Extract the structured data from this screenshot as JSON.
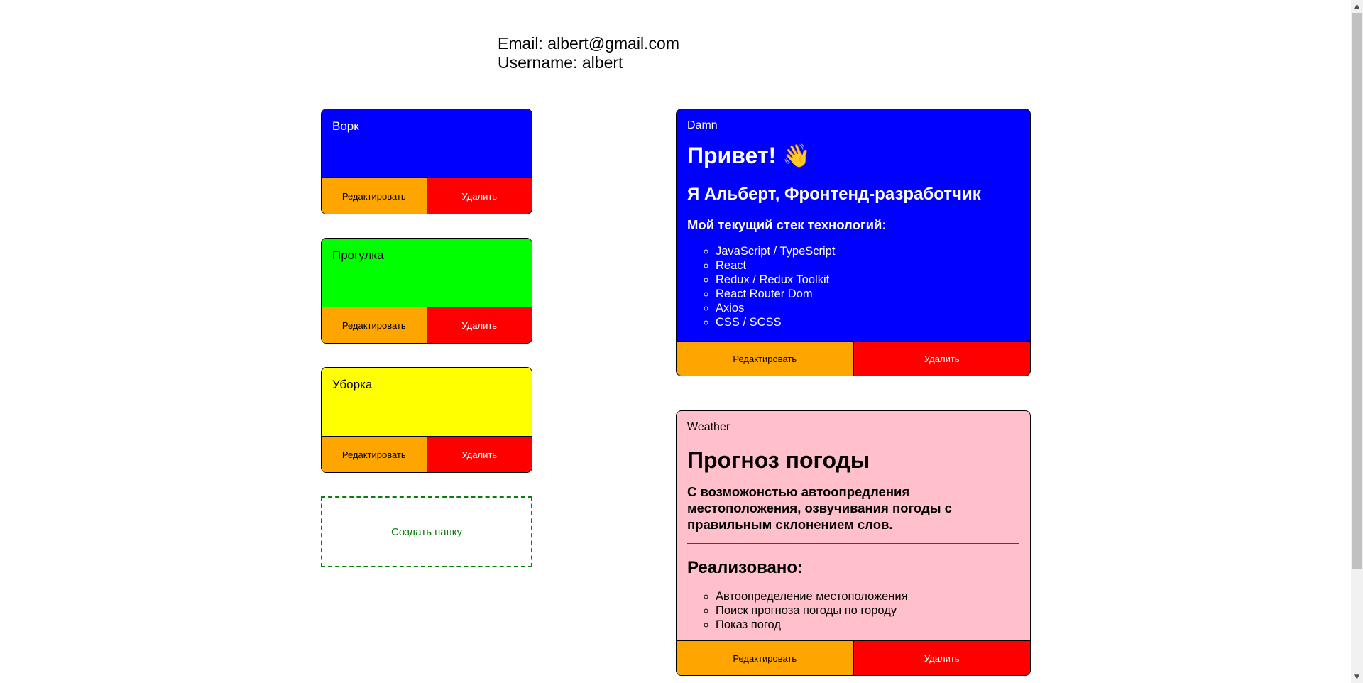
{
  "profile": {
    "email_line": "Email: albert@gmail.com",
    "username_line": "Username: albert"
  },
  "colors": {
    "edit_button": "#ffa500",
    "delete_button": "#ff0000",
    "create_folder_border": "#0a7d0a"
  },
  "folders": [
    {
      "title": "Ворк",
      "color": "#0000ff",
      "edit_label": "Редактировать",
      "delete_label": "Удалить"
    },
    {
      "title": "Прогулка",
      "color": "#00ff00",
      "edit_label": "Редактировать",
      "delete_label": "Удалить"
    },
    {
      "title": "Уборка",
      "color": "#ffff00",
      "edit_label": "Редактировать",
      "delete_label": "Удалить"
    }
  ],
  "create_folder_label": "Создать папку",
  "notes": [
    {
      "tag": "Damn",
      "color": "#0000ff",
      "heading": "Привет! 👋",
      "subheading": "Я Альберт, Фронтенд-разработчик",
      "section_title": "Мой текущий стек технологий:",
      "items": [
        "JavaScript / TypeScript",
        "React",
        "Redux / Redux Toolkit",
        "React Router Dom",
        "Axios",
        "CSS / SCSS"
      ],
      "edit_label": "Редактировать",
      "delete_label": "Удалить"
    },
    {
      "tag": "Weather",
      "color": "#ffc0cb",
      "heading": "Прогноз погоды",
      "description": "С возможонстью автоопредления местоположения, озвучивания погоды с правильным склонением слов.",
      "section_title": "Реализовано:",
      "items": [
        "Автоопределение местоположения",
        "Поиск прогноза погоды по городу",
        "Показ погод"
      ],
      "edit_label": "Редактировать",
      "delete_label": "Удалить"
    }
  ],
  "scrollbar": {
    "up_icon": "▲",
    "down_icon": "▼"
  }
}
